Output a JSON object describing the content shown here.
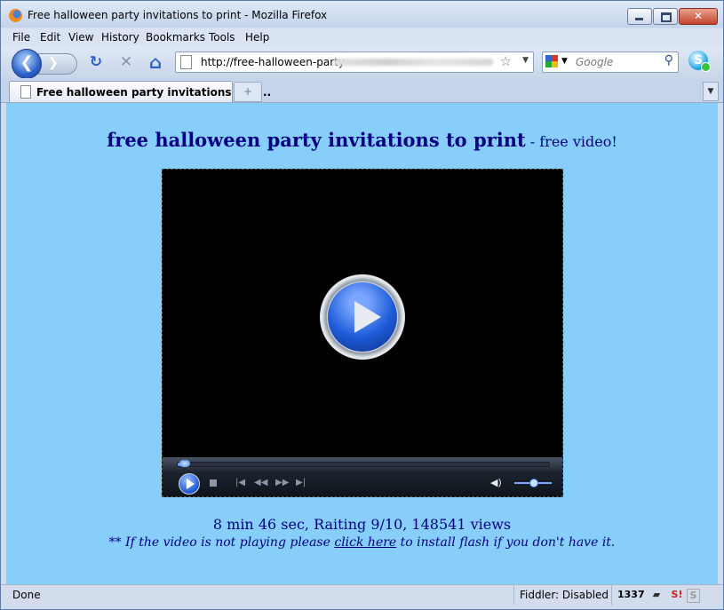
{
  "window": {
    "title": "Free halloween party invitations to print - Mozilla Firefox",
    "close_symbol": "✕"
  },
  "menu": [
    "File",
    "Edit",
    "View",
    "History",
    "Bookmarks",
    "Tools",
    "Help"
  ],
  "nav": {
    "back_symbol": "❮",
    "forward_symbol": "❯",
    "reload_symbol": "↻",
    "stop_symbol": "✕",
    "home_symbol": "⌂",
    "url": "http://free-halloween-party",
    "star_symbol": "☆",
    "dropdown_symbol": "▼",
    "search_placeholder": "Google",
    "search_symbol": "⚲",
    "skype_letter": "S"
  },
  "tab": {
    "label": "Free halloween party invitations to p...",
    "new_tab_symbol": "+",
    "list_symbol": "▼"
  },
  "page": {
    "heading_main": "free halloween party invitations to print",
    "heading_sub": " - free video!",
    "stats": "8 min 46 sec, Raiting 9/10, 148541 views",
    "note_prefix": "** If the video is not playing please ",
    "note_link": "click here",
    "note_suffix": " to install flash if you don't have it."
  },
  "player": {
    "progress_fraction": 0.02,
    "volume_fraction": 0.5,
    "prev_symbol": "|◀",
    "rewind_symbol": "◀◀",
    "ffwd_symbol": "▶▶",
    "next_symbol": "▶|",
    "volume_symbol": "◀)"
  },
  "status": {
    "text": "Done",
    "fiddler": "Fiddler: Disabled",
    "counter": "1337",
    "si_text": "S!"
  },
  "colors": {
    "page_bg": "#87cefa",
    "text_navy": "#000080"
  }
}
